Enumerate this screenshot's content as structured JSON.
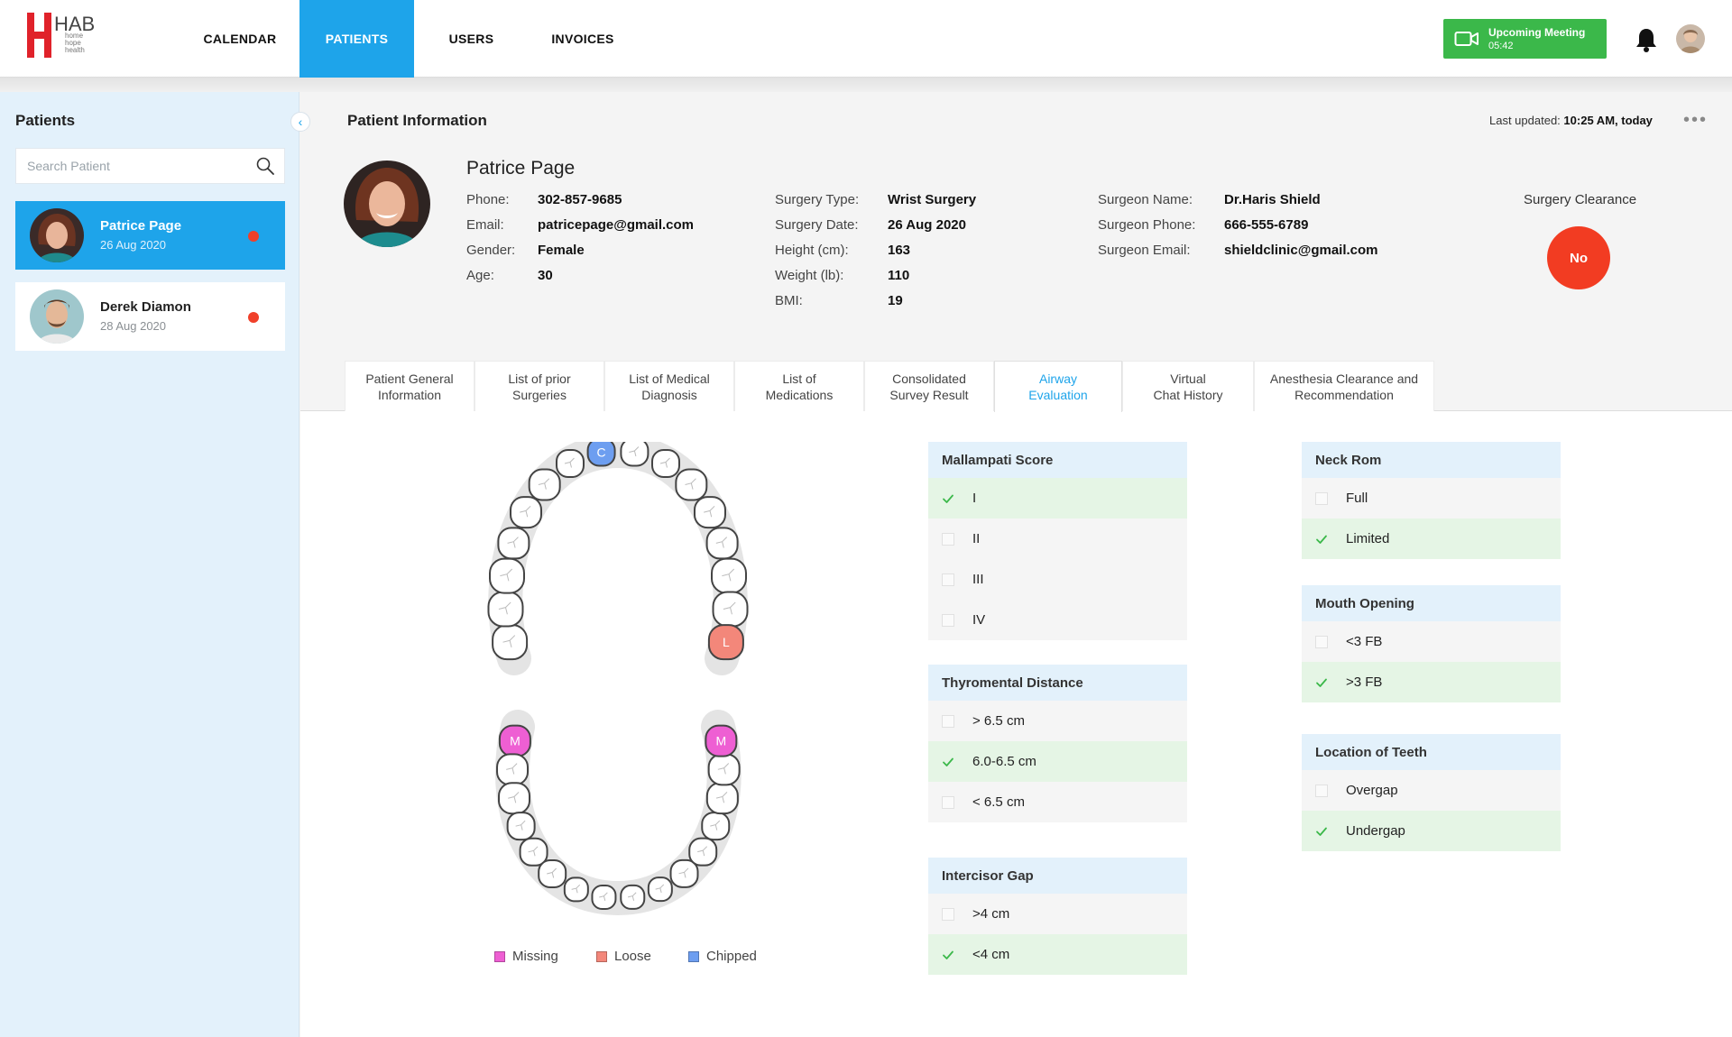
{
  "nav": {
    "items": [
      {
        "label": "CALENDAR"
      },
      {
        "label": "PATIENTS"
      },
      {
        "label": "USERS"
      },
      {
        "label": "INVOICES"
      }
    ],
    "active_index": 1,
    "meeting": {
      "title": "Upcoming Meeting",
      "time": "05:42"
    },
    "logo": {
      "letters": "HAB",
      "text_lines": [
        "home",
        "hope",
        "health"
      ]
    }
  },
  "sidebar": {
    "title": "Patients",
    "search_placeholder": "Search Patient",
    "patients": [
      {
        "name": "Patrice Page",
        "date": "26 Aug 2020",
        "active": true
      },
      {
        "name": "Derek Diamon",
        "date": "28 Aug 2020",
        "active": false
      }
    ]
  },
  "main": {
    "title": "Patient Information",
    "last_updated_label": "Last updated:",
    "last_updated_value": "10:25 AM, today"
  },
  "patient": {
    "name": "Patrice Page",
    "col1": [
      {
        "label": "Phone:",
        "value": "302-857-9685"
      },
      {
        "label": "Email:",
        "value": "patricepage@gmail.com"
      },
      {
        "label": "Gender:",
        "value": "Female"
      },
      {
        "label": "Age:",
        "value": "30"
      }
    ],
    "col2": [
      {
        "label": "Surgery Type:",
        "value": "Wrist Surgery"
      },
      {
        "label": "Surgery Date:",
        "value": "26 Aug 2020"
      },
      {
        "label": "Height (cm):",
        "value": "163"
      },
      {
        "label": "Weight (lb):",
        "value": "110"
      },
      {
        "label": "BMI:",
        "value": "19"
      }
    ],
    "col3": [
      {
        "label": "Surgeon Name:",
        "value": "Dr.Haris Shield"
      },
      {
        "label": "Surgeon Phone:",
        "value": "666-555-6789"
      },
      {
        "label": "Surgeon Email:",
        "value": "shieldclinic@gmail.com"
      }
    ],
    "clearance": {
      "label": "Surgery Clearance",
      "value": "No",
      "color": "#f23c22"
    }
  },
  "tabs": [
    {
      "line1": "Patient General",
      "line2": "Information"
    },
    {
      "line1": "List of prior",
      "line2": "Surgeries"
    },
    {
      "line1": "List of Medical",
      "line2": "Diagnosis"
    },
    {
      "line1": "List of",
      "line2": "Medications"
    },
    {
      "line1": "Consolidated",
      "line2": "Survey Result"
    },
    {
      "line1": "Airway",
      "line2": "Evaluation"
    },
    {
      "line1": "Virtual",
      "line2": "Chat History"
    },
    {
      "line1": "Anesthesia Clearance and",
      "line2": "Recommendation"
    }
  ],
  "active_tab": 5,
  "teeth": {
    "markers": {
      "chipped": "C",
      "loose": "L",
      "missing": "M"
    },
    "legend": [
      {
        "label": "Missing",
        "color": "#ee5fd3"
      },
      {
        "label": "Loose",
        "color": "#f3877a"
      },
      {
        "label": "Chipped",
        "color": "#6d9ef0"
      }
    ]
  },
  "evaluation": {
    "mallampati": {
      "title": "Mallampati Score",
      "options": [
        {
          "label": "I",
          "checked": true
        },
        {
          "label": "II",
          "checked": false
        },
        {
          "label": "III",
          "checked": false
        },
        {
          "label": "IV",
          "checked": false
        }
      ]
    },
    "thyromental": {
      "title": "Thyromental Distance",
      "options": [
        {
          "label": "> 6.5 cm",
          "checked": false
        },
        {
          "label": "6.0-6.5 cm",
          "checked": true
        },
        {
          "label": "< 6.5 cm",
          "checked": false
        }
      ]
    },
    "intercisor": {
      "title": "Intercisor Gap",
      "options": [
        {
          "label": ">4 cm",
          "checked": false
        },
        {
          "label": "<4 cm",
          "checked": true
        }
      ]
    },
    "neck_rom": {
      "title": "Neck Rom",
      "options": [
        {
          "label": "Full",
          "checked": false
        },
        {
          "label": "Limited",
          "checked": true
        }
      ]
    },
    "mouth_opening": {
      "title": "Mouth Opening",
      "options": [
        {
          "label": "<3 FB",
          "checked": false
        },
        {
          "label": ">3 FB",
          "checked": true
        }
      ]
    },
    "location_teeth": {
      "title": "Location of Teeth",
      "options": [
        {
          "label": "Overgap",
          "checked": false
        },
        {
          "label": "Undergap",
          "checked": true
        }
      ]
    }
  },
  "colors": {
    "accent": "#1ea4ea",
    "meeting": "#3bb84a",
    "danger": "#f23c22",
    "selected_row": "#e5f5e5",
    "check": "#3bb84a"
  }
}
